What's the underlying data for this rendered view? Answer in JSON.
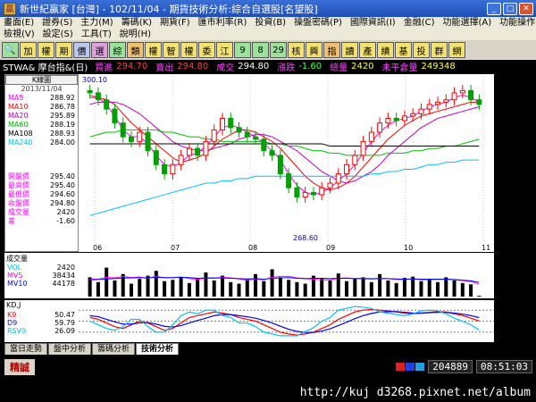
{
  "window": {
    "app": "新世紀贏家",
    "market": "[台灣]",
    "date": "102/11/04",
    "title": "期貨技術分析:綜合自選股[名望股]",
    "icon": "app-icon"
  },
  "menu": {
    "row1": [
      "畫面(E)",
      "證券(S)",
      "主力(M)",
      "籌碼(K)",
      "期貨(F)",
      "匯市利率(R)",
      "投資(B)",
      "操盤密碼(P)",
      "國際資訊(I)",
      "金融(C)",
      "功能選擇(A)",
      "功能操作(D)"
    ],
    "row2": [
      "檢視(V)",
      "設定(S)",
      "工具(T)",
      "說明(H)"
    ]
  },
  "toolbar": [
    "加",
    "權",
    "期",
    "價",
    "選",
    "綜",
    "類",
    "權",
    "智",
    "權",
    "委",
    "江",
    "9",
    "8",
    "29",
    "核",
    "興",
    "指",
    "讀",
    "產",
    "績",
    "基",
    "投",
    "群",
    "網"
  ],
  "info": {
    "symbol": "STWA& 摩台指&(日)",
    "bid_label": "買進",
    "bid": "294.70",
    "ask_label": "賣出",
    "ask": "294.80",
    "last_label": "成交",
    "last": "294.80",
    "chg_label": "漲跌",
    "chg": "-1.60",
    "vol_label": "總量",
    "vol": "2420",
    "oi_label": "未平倉量",
    "oi": "249348"
  },
  "sidebar": {
    "button": "K線圖",
    "date": "2013/11/04",
    "ma": [
      {
        "name": "MA5",
        "value": "288.92",
        "color": "#ff00ff"
      },
      {
        "name": "MA10",
        "value": "286.78",
        "color": "#ff0000"
      },
      {
        "name": "MA20",
        "value": "295.89",
        "color": "#c000c0"
      },
      {
        "name": "MA60",
        "value": "288.19",
        "color": "#00c000"
      },
      {
        "name": "MA108",
        "value": "288.93",
        "color": "#000000"
      },
      {
        "name": "MA240",
        "value": "284.00",
        "color": "#00c0ff"
      }
    ],
    "prices": [
      {
        "name": "開盤價",
        "value": "295.40"
      },
      {
        "name": "最高價",
        "value": "295.40"
      },
      {
        "name": "最低價",
        "value": "294.60"
      },
      {
        "name": "收盤價",
        "value": "294.80"
      },
      {
        "name": "成交量",
        "value": "2420"
      },
      {
        "name": "差",
        "value": "-1.60"
      }
    ]
  },
  "main": {
    "top_label": "300.10",
    "low_label": "268.60",
    "yticks": [
      "300",
      "295",
      "290",
      "285",
      "280",
      "275",
      "270"
    ],
    "months": [
      "06",
      "07",
      "08",
      "09",
      "10",
      "11"
    ]
  },
  "volume": {
    "title": "成交量",
    "rows": [
      {
        "name": "VOL",
        "value": "2420",
        "color": "#00c0ff"
      },
      {
        "name": "MV5",
        "value": "38434",
        "color": "#ff00ff"
      },
      {
        "name": "MV10",
        "value": "44178",
        "color": "#0000ff"
      }
    ],
    "yticks": [
      "125000",
      "50000",
      "0"
    ]
  },
  "kd": {
    "title": "KD,J",
    "rows": [
      {
        "name": "K9",
        "value": "50.47",
        "color": "#ff0000"
      },
      {
        "name": "D9",
        "value": "59.79",
        "color": "#0000ff"
      },
      {
        "name": "RSV9",
        "value": "26.09",
        "color": "#00c0ff"
      }
    ],
    "yticks": [
      "80",
      "50",
      "20"
    ]
  },
  "tabs": [
    "當日走勢",
    "盤中分析",
    "籌碼分析",
    "技術分析"
  ],
  "status": {
    "left": "精誠",
    "count": "204889",
    "clock": "08:51:03"
  },
  "footer": "http://kuj d3268.pixnet.net/album",
  "chart_data": [
    {
      "type": "candlestick",
      "title": "STWA& 摩台指&(日)",
      "x": [
        "06",
        "07",
        "08",
        "09",
        "10",
        "11"
      ],
      "ylim": [
        268,
        301
      ],
      "annotations": [
        "300.10",
        "268.60"
      ],
      "close": [
        298.5,
        297,
        295,
        292,
        289,
        288,
        290,
        286,
        283,
        281,
        283,
        285,
        286.5,
        285,
        288,
        290.5,
        293,
        291,
        290,
        289,
        288.5,
        286,
        285,
        281,
        278,
        276,
        277,
        276.5,
        278,
        279,
        281,
        283,
        285,
        288,
        290,
        292,
        293,
        292.5,
        293.5,
        294,
        295,
        296,
        296.5,
        297,
        298.5,
        299,
        297,
        296
      ],
      "series": [
        {
          "name": "MA5",
          "values": [
            298,
            297.5,
            296,
            293.5,
            290.5,
            289,
            289,
            287.5,
            285,
            283,
            282.5,
            283.5,
            285,
            285.5,
            287,
            289,
            291,
            291.5,
            291,
            290,
            289,
            287.5,
            286,
            284,
            281,
            278.5,
            277,
            276.5,
            277,
            278,
            279.5,
            281,
            283,
            285.5,
            288,
            290,
            291.5,
            292.5,
            293,
            293.5,
            294.5,
            295.5,
            296,
            296.5,
            297.5,
            298,
            297.5,
            296.5
          ]
        },
        {
          "name": "MA10",
          "values": [
            297.5,
            297.5,
            297,
            296,
            294,
            292,
            290.5,
            289,
            287.5,
            286,
            284.5,
            283.5,
            284,
            284.5,
            285.5,
            287,
            288.5,
            289.5,
            290.5,
            290.5,
            290,
            289,
            288,
            286.5,
            284.5,
            282.5,
            280.5,
            279,
            278,
            277.5,
            278,
            279,
            280.5,
            282.5,
            284.5,
            286.5,
            288.5,
            290,
            291.5,
            292.5,
            293.5,
            294,
            294.5,
            295,
            295.5,
            296,
            296.5,
            296.5
          ]
        },
        {
          "name": "MA20",
          "values": [
            296,
            296.5,
            296.5,
            296.5,
            296,
            295,
            294,
            292.5,
            291,
            289.5,
            288,
            287,
            286.5,
            286,
            286,
            286.5,
            287,
            287.5,
            288.5,
            289,
            289.5,
            289.5,
            289,
            288,
            287,
            286,
            284.5,
            283,
            281.5,
            280.5,
            279.5,
            279,
            279.5,
            280.5,
            281.5,
            283,
            285,
            286.5,
            288,
            289.5,
            291,
            292,
            293,
            293.5,
            294,
            294.5,
            295,
            295.5
          ]
        },
        {
          "name": "MA60",
          "values": [
            289,
            289.5,
            290,
            290,
            290.5,
            290.5,
            290.5,
            290.5,
            290.5,
            290,
            290,
            289.5,
            289,
            289,
            288.5,
            288.5,
            288,
            288,
            288,
            288,
            288,
            288,
            287.5,
            287.5,
            287,
            287,
            286.5,
            286,
            286,
            285.5,
            285.5,
            285,
            285,
            285,
            285,
            285,
            285.5,
            285.5,
            285.5,
            286,
            286,
            286.5,
            286.5,
            287,
            287,
            287.5,
            288,
            288.5
          ]
        },
        {
          "name": "MA108",
          "values": [
            287.5,
            287.5,
            287.5,
            287.5,
            287.5,
            287.5,
            287.5,
            287.5,
            287.5,
            287.5,
            287.5,
            287.5,
            287.5,
            287.5,
            287.5,
            287.5,
            287.5,
            287.5,
            287.5,
            287.5,
            287.5,
            287.5,
            287.5,
            287.5,
            287.5,
            287.5,
            287.5,
            287.5,
            287.5,
            287,
            287,
            287,
            287,
            287,
            287,
            287,
            287,
            287,
            287,
            287,
            287,
            287,
            287,
            287,
            287,
            287,
            287,
            287
          ]
        },
        {
          "name": "MA240",
          "values": [
            272,
            272.5,
            273,
            273.5,
            274,
            274.5,
            275,
            275.5,
            276,
            276.5,
            277,
            277.5,
            278,
            278.5,
            279,
            279,
            279.5,
            279.5,
            280,
            280,
            280.5,
            280.5,
            280.5,
            280.5,
            280.5,
            280.5,
            280.5,
            280.5,
            280.5,
            280.5,
            280.5,
            280.5,
            280.5,
            280.5,
            281,
            281,
            281.5,
            281.5,
            282,
            282,
            282.5,
            283,
            283,
            283.5,
            283.5,
            284,
            284,
            284
          ]
        }
      ]
    },
    {
      "type": "bar",
      "title": "成交量",
      "ylim": [
        0,
        125000
      ],
      "values": [
        60000,
        45000,
        90000,
        50000,
        70000,
        40000,
        55000,
        65000,
        80000,
        48000,
        52000,
        60000,
        42000,
        58000,
        75000,
        50000,
        65000,
        45000,
        40000,
        55000,
        70000,
        48000,
        85000,
        60000,
        52000,
        45000,
        40000,
        65000,
        58000,
        50000,
        72000,
        48000,
        55000,
        60000,
        45000,
        70000,
        50000,
        42000,
        58000,
        62000,
        48000,
        55000,
        45000,
        60000,
        50000,
        42000,
        38000,
        2420
      ],
      "series": [
        {
          "name": "MV5",
          "values": [
            55000,
            54000,
            60000,
            58000,
            63000,
            59000,
            61000,
            56000,
            64000,
            58000,
            59000,
            61000,
            56000,
            54000,
            57000,
            57000,
            60000,
            58000,
            55000,
            51000,
            55000,
            52000,
            60000,
            63000,
            63000,
            58000,
            56000,
            54000,
            52000,
            52000,
            57000,
            58000,
            56000,
            57000,
            56000,
            57000,
            56000,
            53000,
            53000,
            56000,
            52000,
            53000,
            53000,
            54000,
            52000,
            50000,
            47000,
            38434
          ]
        },
        {
          "name": "MV10",
          "values": [
            52000,
            53000,
            55000,
            56000,
            58000,
            58000,
            59000,
            58000,
            60000,
            59000,
            59000,
            60000,
            59000,
            57000,
            58000,
            58000,
            58000,
            57000,
            56000,
            55000,
            56000,
            54000,
            57000,
            58000,
            59000,
            57000,
            56000,
            57000,
            57000,
            56000,
            57000,
            57000,
            56000,
            56000,
            55000,
            56000,
            56000,
            55000,
            54000,
            55000,
            54000,
            54000,
            54000,
            54000,
            53000,
            51000,
            49000,
            44178
          ]
        }
      ]
    },
    {
      "type": "line",
      "title": "KD,J",
      "ylim": [
        0,
        100
      ],
      "series": [
        {
          "name": "K9",
          "values": [
            60,
            55,
            45,
            35,
            30,
            40,
            50,
            45,
            35,
            25,
            30,
            45,
            60,
            65,
            70,
            75,
            72,
            68,
            60,
            55,
            50,
            40,
            30,
            20,
            15,
            12,
            15,
            20,
            30,
            40,
            55,
            65,
            75,
            80,
            82,
            80,
            78,
            75,
            72,
            70,
            72,
            74,
            76,
            75,
            70,
            65,
            58,
            50.47
          ]
        },
        {
          "name": "D9",
          "values": [
            65,
            62,
            55,
            48,
            42,
            42,
            45,
            46,
            42,
            36,
            34,
            38,
            45,
            52,
            58,
            65,
            68,
            68,
            65,
            62,
            58,
            52,
            45,
            36,
            28,
            22,
            19,
            19,
            23,
            29,
            38,
            47,
            57,
            65,
            71,
            75,
            76,
            76,
            74,
            72,
            72,
            73,
            74,
            74,
            72,
            69,
            65,
            59.79
          ]
        },
        {
          "name": "RSV9",
          "values": [
            50,
            40,
            30,
            25,
            35,
            55,
            55,
            35,
            20,
            20,
            40,
            65,
            75,
            70,
            80,
            80,
            65,
            60,
            45,
            45,
            35,
            20,
            15,
            10,
            10,
            10,
            22,
            32,
            50,
            60,
            80,
            85,
            90,
            88,
            85,
            75,
            72,
            68,
            65,
            70,
            78,
            80,
            78,
            70,
            58,
            50,
            40,
            26.09
          ]
        }
      ]
    }
  ]
}
